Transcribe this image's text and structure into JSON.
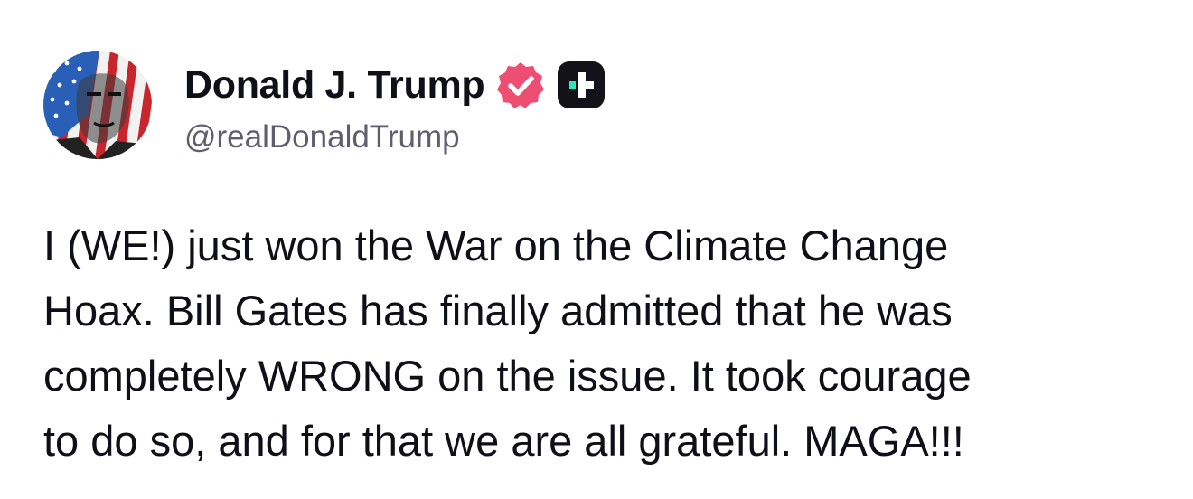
{
  "post": {
    "author": {
      "display_name": "Donald J. Trump",
      "handle": "@realDonaldTrump",
      "verified_icon": "verified-badge-icon",
      "verified_color": "#ee4e72",
      "plus_icon": "truth-social-plus-icon",
      "plus_accent": "#2ee8b6",
      "avatar_icon": "profile-avatar-flag-portrait"
    },
    "body_lines": [
      "I (WE!) just won the War on the Climate Change",
      "Hoax. Bill Gates has finally admitted that he was",
      "completely WRONG on the issue. It took courage",
      "to do so, and for that we are all grateful. MAGA!!!"
    ]
  }
}
